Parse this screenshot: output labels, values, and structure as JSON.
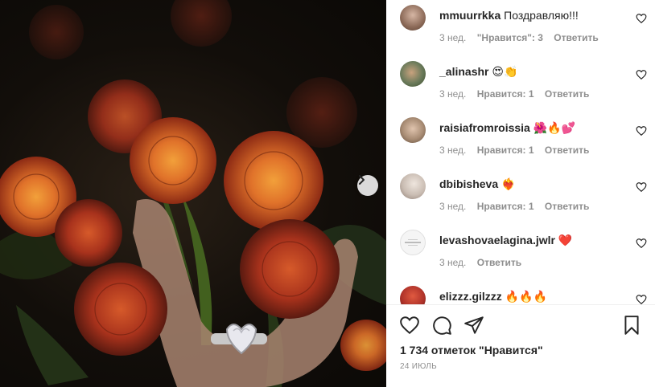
{
  "post": {
    "image_alt": "Photo of marigold flowers with hand wearing heart ring",
    "next_icon": "chevron-right-icon"
  },
  "comments": [
    {
      "username": "mmuurrkka",
      "text": "Поздравляю!!!",
      "age": "3 нед.",
      "likes": "\"Нравится\": 3",
      "reply": "Ответить",
      "avatar_color": "#b08a78"
    },
    {
      "username": "_alinashr",
      "text": "😍👏",
      "age": "3 нед.",
      "likes": "Нравится: 1",
      "reply": "Ответить",
      "avatar_color": "#6a7a5a"
    },
    {
      "username": "raisiafromroissia",
      "text": "🌺🔥💕",
      "age": "3 нед.",
      "likes": "Нравится: 1",
      "reply": "Ответить",
      "avatar_color": "#a88c74"
    },
    {
      "username": "dbibisheva",
      "text": "❤️‍🔥",
      "age": "3 нед.",
      "likes": "Нравится: 1",
      "reply": "Ответить",
      "avatar_color": "#c9bcb2"
    },
    {
      "username": "levashovaelagina.jwlr",
      "text": "❤️",
      "age": "3 нед.",
      "likes": "",
      "reply": "Ответить",
      "avatar_color": "#f2f2f2"
    },
    {
      "username": "elizzz.gilzzz",
      "text": "🔥🔥🔥",
      "age": "",
      "likes": "",
      "reply": "",
      "avatar_color": "#b0332a"
    }
  ],
  "actions": {
    "like_icon": "heart-icon",
    "comment_icon": "comment-icon",
    "share_icon": "send-icon",
    "save_icon": "bookmark-icon"
  },
  "likes_text": "1 734 отметок \"Нравится\"",
  "date_text": "24 ИЮЛЬ"
}
